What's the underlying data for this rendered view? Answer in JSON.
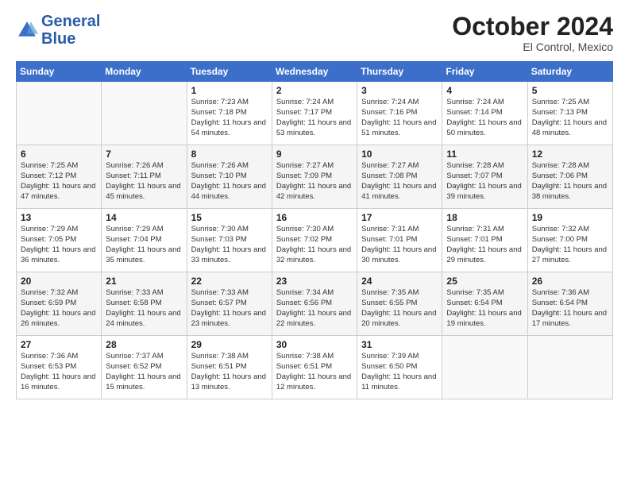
{
  "logo": {
    "line1": "General",
    "line2": "Blue"
  },
  "title": "October 2024",
  "location": "El Control, Mexico",
  "days_of_week": [
    "Sunday",
    "Monday",
    "Tuesday",
    "Wednesday",
    "Thursday",
    "Friday",
    "Saturday"
  ],
  "weeks": [
    [
      {
        "day": "",
        "detail": ""
      },
      {
        "day": "",
        "detail": ""
      },
      {
        "day": "1",
        "detail": "Sunrise: 7:23 AM\nSunset: 7:18 PM\nDaylight: 11 hours\nand 54 minutes."
      },
      {
        "day": "2",
        "detail": "Sunrise: 7:24 AM\nSunset: 7:17 PM\nDaylight: 11 hours\nand 53 minutes."
      },
      {
        "day": "3",
        "detail": "Sunrise: 7:24 AM\nSunset: 7:16 PM\nDaylight: 11 hours\nand 51 minutes."
      },
      {
        "day": "4",
        "detail": "Sunrise: 7:24 AM\nSunset: 7:14 PM\nDaylight: 11 hours\nand 50 minutes."
      },
      {
        "day": "5",
        "detail": "Sunrise: 7:25 AM\nSunset: 7:13 PM\nDaylight: 11 hours\nand 48 minutes."
      }
    ],
    [
      {
        "day": "6",
        "detail": "Sunrise: 7:25 AM\nSunset: 7:12 PM\nDaylight: 11 hours\nand 47 minutes."
      },
      {
        "day": "7",
        "detail": "Sunrise: 7:26 AM\nSunset: 7:11 PM\nDaylight: 11 hours\nand 45 minutes."
      },
      {
        "day": "8",
        "detail": "Sunrise: 7:26 AM\nSunset: 7:10 PM\nDaylight: 11 hours\nand 44 minutes."
      },
      {
        "day": "9",
        "detail": "Sunrise: 7:27 AM\nSunset: 7:09 PM\nDaylight: 11 hours\nand 42 minutes."
      },
      {
        "day": "10",
        "detail": "Sunrise: 7:27 AM\nSunset: 7:08 PM\nDaylight: 11 hours\nand 41 minutes."
      },
      {
        "day": "11",
        "detail": "Sunrise: 7:28 AM\nSunset: 7:07 PM\nDaylight: 11 hours\nand 39 minutes."
      },
      {
        "day": "12",
        "detail": "Sunrise: 7:28 AM\nSunset: 7:06 PM\nDaylight: 11 hours\nand 38 minutes."
      }
    ],
    [
      {
        "day": "13",
        "detail": "Sunrise: 7:29 AM\nSunset: 7:05 PM\nDaylight: 11 hours\nand 36 minutes."
      },
      {
        "day": "14",
        "detail": "Sunrise: 7:29 AM\nSunset: 7:04 PM\nDaylight: 11 hours\nand 35 minutes."
      },
      {
        "day": "15",
        "detail": "Sunrise: 7:30 AM\nSunset: 7:03 PM\nDaylight: 11 hours\nand 33 minutes."
      },
      {
        "day": "16",
        "detail": "Sunrise: 7:30 AM\nSunset: 7:02 PM\nDaylight: 11 hours\nand 32 minutes."
      },
      {
        "day": "17",
        "detail": "Sunrise: 7:31 AM\nSunset: 7:01 PM\nDaylight: 11 hours\nand 30 minutes."
      },
      {
        "day": "18",
        "detail": "Sunrise: 7:31 AM\nSunset: 7:01 PM\nDaylight: 11 hours\nand 29 minutes."
      },
      {
        "day": "19",
        "detail": "Sunrise: 7:32 AM\nSunset: 7:00 PM\nDaylight: 11 hours\nand 27 minutes."
      }
    ],
    [
      {
        "day": "20",
        "detail": "Sunrise: 7:32 AM\nSunset: 6:59 PM\nDaylight: 11 hours\nand 26 minutes."
      },
      {
        "day": "21",
        "detail": "Sunrise: 7:33 AM\nSunset: 6:58 PM\nDaylight: 11 hours\nand 24 minutes."
      },
      {
        "day": "22",
        "detail": "Sunrise: 7:33 AM\nSunset: 6:57 PM\nDaylight: 11 hours\nand 23 minutes."
      },
      {
        "day": "23",
        "detail": "Sunrise: 7:34 AM\nSunset: 6:56 PM\nDaylight: 11 hours\nand 22 minutes."
      },
      {
        "day": "24",
        "detail": "Sunrise: 7:35 AM\nSunset: 6:55 PM\nDaylight: 11 hours\nand 20 minutes."
      },
      {
        "day": "25",
        "detail": "Sunrise: 7:35 AM\nSunset: 6:54 PM\nDaylight: 11 hours\nand 19 minutes."
      },
      {
        "day": "26",
        "detail": "Sunrise: 7:36 AM\nSunset: 6:54 PM\nDaylight: 11 hours\nand 17 minutes."
      }
    ],
    [
      {
        "day": "27",
        "detail": "Sunrise: 7:36 AM\nSunset: 6:53 PM\nDaylight: 11 hours\nand 16 minutes."
      },
      {
        "day": "28",
        "detail": "Sunrise: 7:37 AM\nSunset: 6:52 PM\nDaylight: 11 hours\nand 15 minutes."
      },
      {
        "day": "29",
        "detail": "Sunrise: 7:38 AM\nSunset: 6:51 PM\nDaylight: 11 hours\nand 13 minutes."
      },
      {
        "day": "30",
        "detail": "Sunrise: 7:38 AM\nSunset: 6:51 PM\nDaylight: 11 hours\nand 12 minutes."
      },
      {
        "day": "31",
        "detail": "Sunrise: 7:39 AM\nSunset: 6:50 PM\nDaylight: 11 hours\nand 11 minutes."
      },
      {
        "day": "",
        "detail": ""
      },
      {
        "day": "",
        "detail": ""
      }
    ]
  ]
}
